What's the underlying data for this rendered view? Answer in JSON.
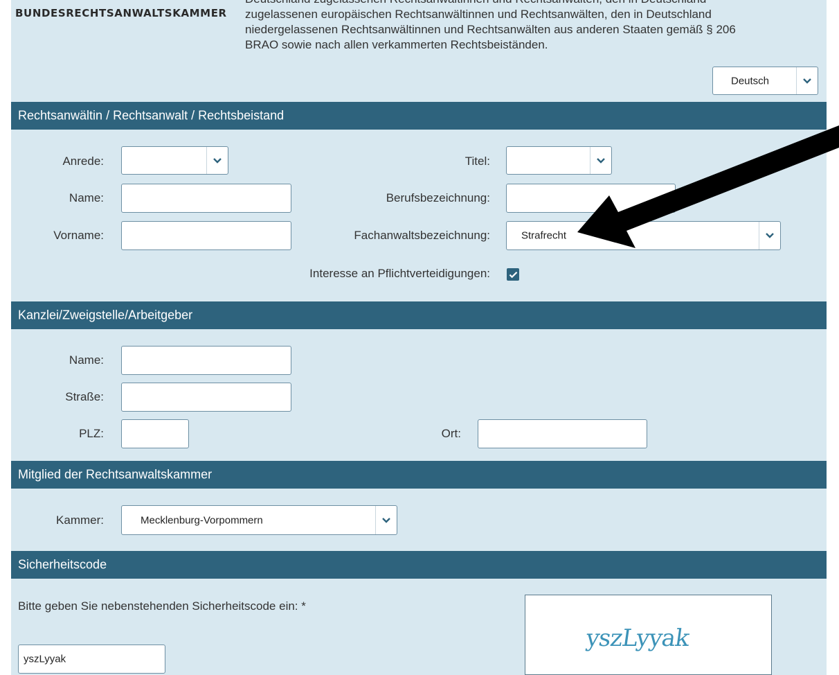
{
  "header": {
    "logo_text": "BUNDESRECHTSANWALTSKAMMER",
    "intro_lines": [
      "Deutschland zugelassenen Rechtsanwältinnen und Rechtsanwälten, den in Deutschland",
      "zugelassenen europäischen Rechtsanwältinnen und Rechtsanwälten, den in Deutschland",
      "niedergelassenen Rechtsanwältinnen und Rechtsanwälten aus anderen Staaten gemäß § 206",
      "BRAO sowie nach allen verkammerten Rechtsbeiständen."
    ],
    "language_select": {
      "value": "Deutsch"
    }
  },
  "section_lawyer": {
    "title": "Rechtsanwältin / Rechtsanwalt / Rechtsbeistand",
    "anrede_label": "Anrede:",
    "anrede_value": "",
    "titel_label": "Titel:",
    "titel_value": "",
    "name_label": "Name:",
    "name_value": "",
    "berufsbezeichnung_label": "Berufsbezeichnung:",
    "berufsbezeichnung_value": "",
    "vorname_label": "Vorname:",
    "vorname_value": "",
    "fachanwalt_label": "Fachanwaltsbezeichnung:",
    "fachanwalt_value": "Strafrecht",
    "pflicht_label": "Interesse an Pflichtverteidigungen:",
    "pflicht_checked": true
  },
  "section_office": {
    "title": "Kanzlei/Zweigstelle/Arbeitgeber",
    "name_label": "Name:",
    "name_value": "",
    "strasse_label": "Straße:",
    "strasse_value": "",
    "plz_label": "PLZ:",
    "plz_value": "",
    "ort_label": "Ort:",
    "ort_value": ""
  },
  "section_chamber": {
    "title": "Mitglied der Rechtsanwaltskammer",
    "kammer_label": "Kammer:",
    "kammer_value": "Mecklenburg-Vorpommern"
  },
  "section_captcha": {
    "title": "Sicherheitscode",
    "prompt": "Bitte geben Sie nebenstehenden Sicherheitscode ein: *",
    "input_value": "yszLyyak",
    "image_text": "yszLyyak"
  },
  "colors": {
    "header_bar": "#2e637d",
    "background": "#d8e8f0",
    "captcha_text": "#3c93b8"
  },
  "icons": {
    "dropdown": "chevron-down-icon",
    "checkbox": "checkmark-icon",
    "annotation": "arrow-pointer"
  }
}
